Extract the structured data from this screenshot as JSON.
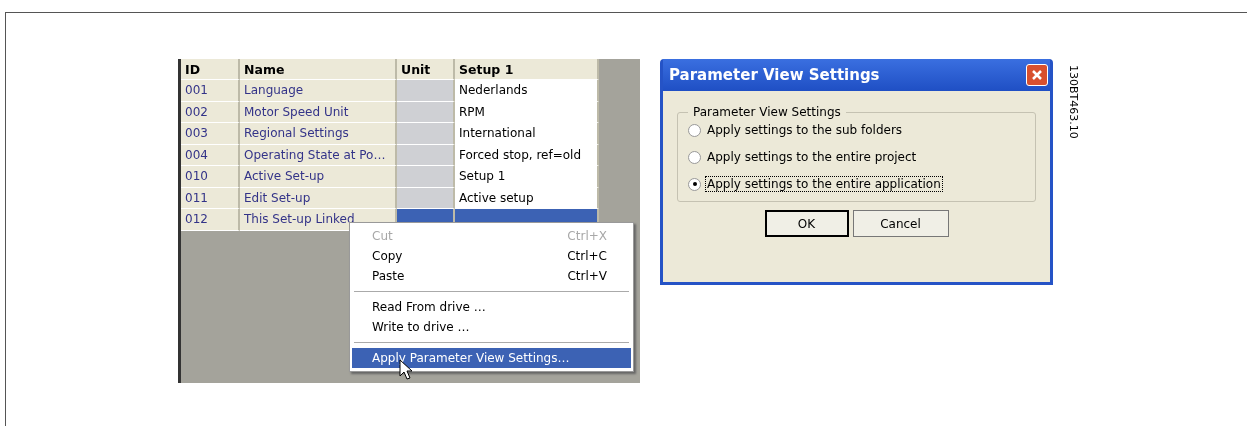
{
  "table": {
    "columns": [
      "ID",
      "Name",
      "Unit",
      "Setup 1"
    ],
    "rows": [
      {
        "id": "001",
        "name": "Language",
        "setup_1": "Nederlands",
        "selected": false
      },
      {
        "id": "002",
        "name": "Motor Speed Unit",
        "setup_1": "RPM",
        "selected": false
      },
      {
        "id": "003",
        "name": "Regional Settings",
        "setup_1": "International",
        "selected": false
      },
      {
        "id": "004",
        "name": "Operating State at Po…",
        "setup_1": "Forced stop, ref=old",
        "selected": false
      },
      {
        "id": "010",
        "name": "Active Set-up",
        "setup_1": "Setup 1",
        "selected": false
      },
      {
        "id": "011",
        "name": "Edit Set-up",
        "setup_1": "Active setup",
        "selected": false
      },
      {
        "id": "012",
        "name": "This Set-up Linked",
        "selected": true
      }
    ]
  },
  "context_menu": {
    "items": [
      {
        "kind": "item",
        "label": "Cut",
        "shortcut": "Ctrl+X",
        "disabled": true,
        "selected": false
      },
      {
        "kind": "item",
        "label": "Copy",
        "shortcut": "Ctrl+C",
        "disabled": false,
        "selected": false
      },
      {
        "kind": "item",
        "label": "Paste",
        "shortcut": "Ctrl+V",
        "disabled": false,
        "selected": false
      },
      {
        "kind": "separator"
      },
      {
        "kind": "item",
        "label": "Read From drive …",
        "disabled": false,
        "selected": false
      },
      {
        "kind": "item",
        "label": "Write to drive …",
        "disabled": false,
        "selected": false
      },
      {
        "kind": "separator"
      },
      {
        "kind": "item",
        "label": "Apply Parameter View Settings…",
        "disabled": false,
        "selected": true
      }
    ]
  },
  "dialog": {
    "title": "Parameter View Settings",
    "group_title": "Parameter View Settings",
    "options": [
      {
        "label": "Apply settings to the sub folders",
        "selected": false
      },
      {
        "label": "Apply settings to the entire project",
        "selected": false
      },
      {
        "label": "Apply settings to the entire application",
        "selected": true
      }
    ],
    "buttons": [
      {
        "label": "OK",
        "default": true
      },
      {
        "label": "Cancel",
        "default": false
      }
    ]
  },
  "figure_code": "130BT463.10"
}
